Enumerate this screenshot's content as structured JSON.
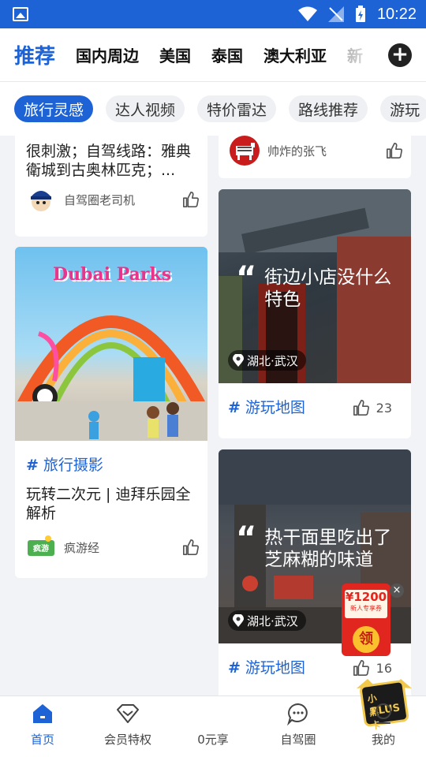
{
  "status_bar": {
    "time": "10:22"
  },
  "top_tabs": [
    "推荐",
    "国内周边",
    "美国",
    "泰国",
    "澳大利亚",
    "新"
  ],
  "sub_tabs": [
    "旅行灵感",
    "达人视频",
    "特价雷达",
    "路线推荐",
    "游玩"
  ],
  "cards": {
    "left_top": {
      "title": "很刺激；自驾线路：雅典衛城到古奥林匹克；...",
      "author": "自驾圈老司机"
    },
    "right_top": {
      "author": "帅炸的张飞"
    },
    "dubai": {
      "image_text": "Dubai Parks",
      "tag": "旅行摄影",
      "title": "玩转二次元 | 迪拜乐园全解析",
      "author": "疯游经"
    },
    "shop": {
      "quote": "街边小店没什么特色",
      "location": "湖北·武汉",
      "tag": "游玩地图",
      "likes": "23"
    },
    "noodle": {
      "quote": "热干面里吃出了芝麻糊的味道",
      "location": "湖北·武汉",
      "tag": "游玩地图",
      "likes": "16"
    }
  },
  "coupon": {
    "amount": "¥1200",
    "label": "新人专享券",
    "action": "领"
  },
  "bottom_nav": [
    {
      "label": "首页",
      "icon": "home-icon"
    },
    {
      "label": "会员特权",
      "icon": "diamond-icon"
    },
    {
      "label": "0元享",
      "icon": "plus-card-icon"
    },
    {
      "label": "自驾圈",
      "icon": "chat-icon"
    },
    {
      "label": "我的",
      "icon": "profile-icon"
    }
  ],
  "plus_badge": {
    "line1": "小黑卡",
    "line2": "PLUS"
  },
  "colors": {
    "accent": "#1e63d5",
    "coupon_red": "#e0261f"
  }
}
